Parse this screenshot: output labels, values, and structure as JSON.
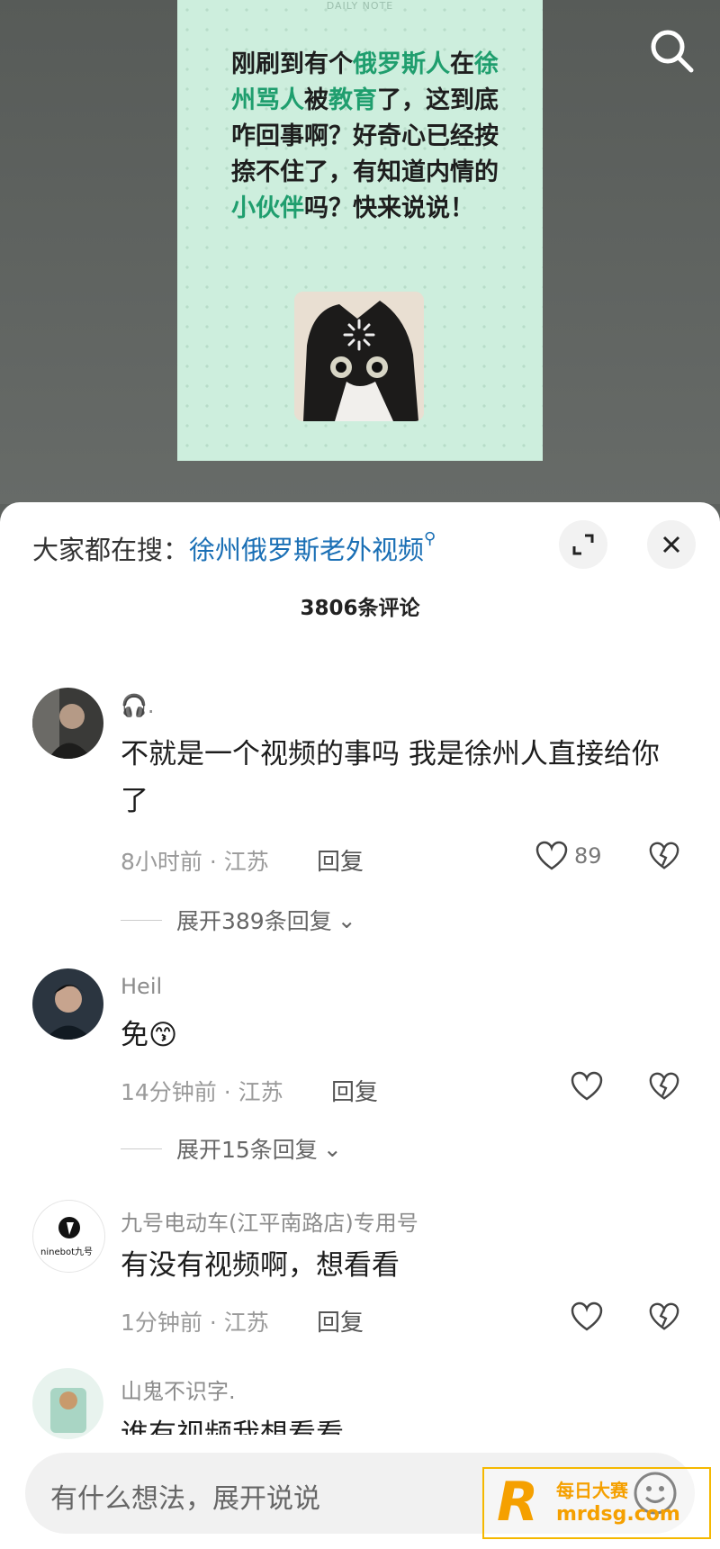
{
  "note_card": {
    "header": "DAILY NOTE",
    "segments": [
      {
        "t": "刚刷到有个",
        "h": false
      },
      {
        "t": "俄罗斯人",
        "h": true
      },
      {
        "t": "在",
        "h": false
      },
      {
        "t": "徐州骂人",
        "h": true
      },
      {
        "t": "被",
        "h": false
      },
      {
        "t": "教育",
        "h": true
      },
      {
        "t": "了，这到底咋回事啊？好奇心已经按捺不住了，有知道内情的",
        "h": false
      },
      {
        "t": "小伙伴",
        "h": true
      },
      {
        "t": "吗？快来说说！",
        "h": false
      }
    ]
  },
  "trending": {
    "prefix": "大家都在搜：",
    "query": "徐州俄罗斯老外视频"
  },
  "comment_count": "3806条评论",
  "comments": [
    {
      "name": "🎧.",
      "text": "不就是一个视频的事吗 我是徐州人直接给你了",
      "time": "8小时前 · 江苏",
      "reply": "回复",
      "likes": "89",
      "expand": "展开389条回复"
    },
    {
      "name": "Heil",
      "text": "免",
      "emoji": "😙",
      "time": "14分钟前 · 江苏",
      "reply": "回复",
      "likes": "",
      "expand": "展开15条回复"
    },
    {
      "name": "九号电动车(江平南路店)专用号",
      "avatar_text": "ninebot九号",
      "text": "有没有视频啊，想看看",
      "time": "1分钟前 · 江苏",
      "reply": "回复",
      "likes": ""
    },
    {
      "name": "山鬼不识字.",
      "text": "谁有视频我想看看"
    }
  ],
  "input": {
    "placeholder": "有什么想法，展开说说"
  },
  "watermark": {
    "line1": "每日大赛",
    "line2": "mrdsg.com"
  },
  "colors": {
    "highlight": "#1f9e6e",
    "link": "#1a6fb5",
    "watermark": "#f5a000"
  }
}
